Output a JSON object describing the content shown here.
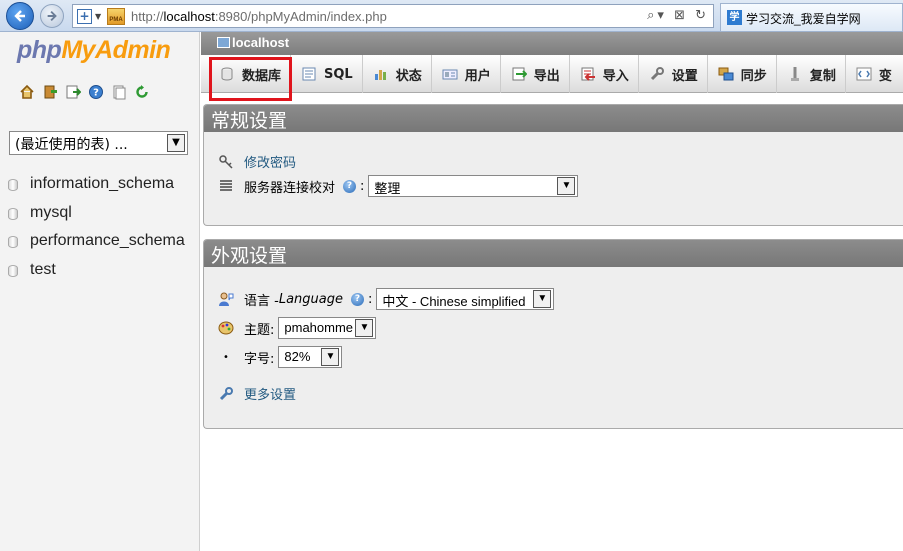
{
  "browser": {
    "url_prefix": "http://",
    "url_host": "localhost",
    "url_rest": ":8980/phpMyAdmin/index.php",
    "tab_title": "学习交流_我爱自学网"
  },
  "sidebar": {
    "logo_php": "php",
    "logo_myadmin": "MyAdmin",
    "recent_select": "(最近使用的表) ...",
    "databases": [
      "information_schema",
      "mysql",
      "performance_schema",
      "test"
    ]
  },
  "server": {
    "label": "localhost"
  },
  "menu": {
    "databases": "数据库",
    "sql": "SQL",
    "status": "状态",
    "users": "用户",
    "export": "导出",
    "import": "导入",
    "settings": "设置",
    "sync": "同步",
    "replication": "复制",
    "variables": "变"
  },
  "general": {
    "title": "常规设置",
    "change_password": "修改密码",
    "collation_label": "服务器连接校对",
    "collation_value": "整理"
  },
  "appearance": {
    "title": "外观设置",
    "language_label": "语言 - ",
    "language_italic": "Language",
    "language_value": "中文 - Chinese simplified",
    "theme_label": "主题:",
    "theme_value": "pmahomme",
    "fontsize_label": "字号:",
    "fontsize_value": "82%",
    "more_settings": "更多设置"
  },
  "colors": {
    "highlight": "#e0141c",
    "link": "#235a81",
    "logo_php": "#6c78af",
    "logo_myadmin": "#f89c0e"
  }
}
